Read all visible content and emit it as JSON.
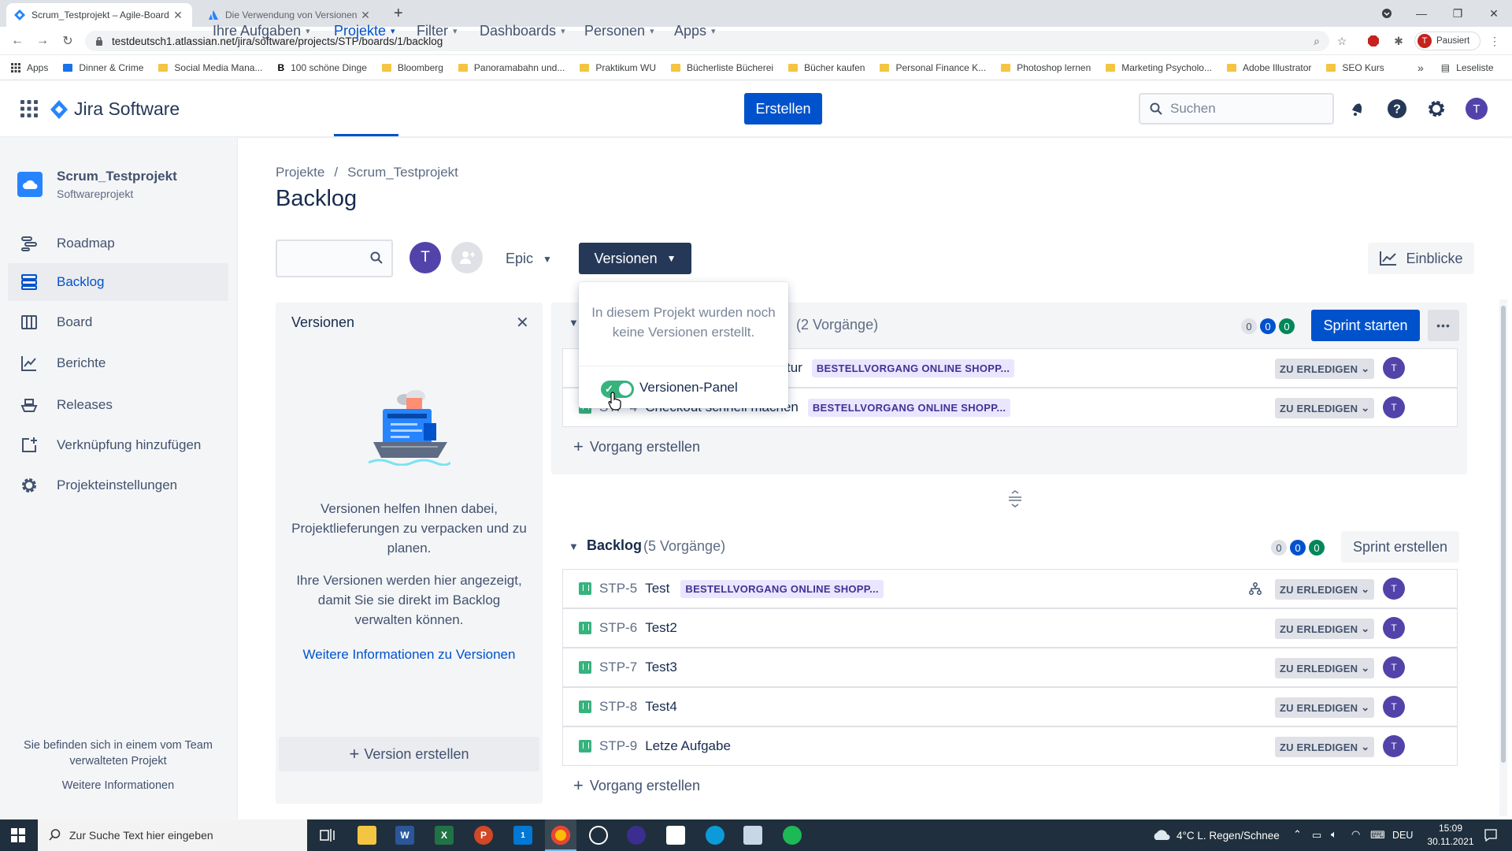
{
  "browser": {
    "tabs": [
      {
        "title": "Scrum_Testprojekt – Agile-Board"
      },
      {
        "title": "Die Verwendung von Versionen"
      }
    ],
    "url": "testdeutsch1.atlassian.net/jira/software/projects/STP/boards/1/backlog",
    "profile_label": "Pausiert",
    "profile_initial": "T",
    "bookmarks": [
      "Apps",
      "Dinner & Crime",
      "Social Media Mana...",
      "100 schöne Dinge",
      "Bloomberg",
      "Panoramabahn und...",
      "Praktikum WU",
      "Bücherliste Bücherei",
      "Bücher kaufen",
      "Personal Finance K...",
      "Photoshop lernen",
      "Marketing Psycholo...",
      "Adobe Illustrator",
      "SEO Kurs"
    ],
    "more_bookmarks": "»",
    "reading_list": "Leseliste"
  },
  "jira": {
    "product": "Jira Software",
    "nav": [
      {
        "label": "Ihre Aufgaben"
      },
      {
        "label": "Projekte"
      },
      {
        "label": "Filter"
      },
      {
        "label": "Dashboards"
      },
      {
        "label": "Personen"
      },
      {
        "label": "Apps"
      }
    ],
    "create_label": "Erstellen",
    "search_placeholder": "Suchen",
    "user_initial": "T",
    "accent": "#0052cc"
  },
  "sidebar": {
    "project_name": "Scrum_Testprojekt",
    "project_type": "Softwareprojekt",
    "items": [
      {
        "label": "Roadmap",
        "icon": "roadmap-icon"
      },
      {
        "label": "Backlog",
        "icon": "backlog-icon"
      },
      {
        "label": "Board",
        "icon": "board-icon"
      },
      {
        "label": "Berichte",
        "icon": "reports-icon"
      },
      {
        "label": "Releases",
        "icon": "releases-icon"
      },
      {
        "label": "Verknüpfung hinzufügen",
        "icon": "add-shortcut-icon"
      },
      {
        "label": "Projekteinstellungen",
        "icon": "settings-icon"
      }
    ],
    "footer_text": "Sie befinden sich in einem vom Team verwalteten Projekt",
    "footer_link": "Weitere Informationen"
  },
  "main": {
    "breadcrumb": [
      "Projekte",
      "Scrum_Testprojekt"
    ],
    "breadcrumb_sep": "/",
    "title": "Backlog",
    "filter_avatar": "T",
    "epic_label": "Epic",
    "versions_label": "Versionen",
    "insights_label": "Einblicke"
  },
  "versions_dropdown": {
    "message": "In diesem Projekt wurden noch keine Versionen erstellt.",
    "toggle_label": "Versionen-Panel",
    "toggle_on": true
  },
  "versions_panel": {
    "title": "Versionen",
    "text1": "Versionen helfen Ihnen dabei, Projektlieferungen zu verpacken und zu planen.",
    "text2": "Ihre Versionen werden hier angezeigt, damit Sie sie direkt im Backlog verwalten können.",
    "link": "Weitere Informationen zu Versionen",
    "create_label": "Version erstellen"
  },
  "sprint": {
    "count_label": "(2 Vorgänge)",
    "badges": [
      "0",
      "0",
      "0"
    ],
    "start_label": "Sprint starten",
    "more_label": "•••",
    "rows": [
      {
        "key": "",
        "summary": "tur",
        "epic": "BESTELLVORGANG ONLINE SHOPP...",
        "status": "ZU ERLEDIGEN",
        "assignee": "T"
      },
      {
        "key": "STP-4",
        "summary": "Checkout schnell machen",
        "epic": "BESTELLVORGANG ONLINE SHOPP...",
        "status": "ZU ERLEDIGEN",
        "assignee": "T"
      }
    ],
    "create_issue": "Vorgang erstellen"
  },
  "backlog": {
    "title": "Backlog",
    "count_label": "(5 Vorgänge)",
    "badges": [
      "0",
      "0",
      "0"
    ],
    "create_sprint": "Sprint erstellen",
    "rows": [
      {
        "key": "STP-5",
        "summary": "Test",
        "epic": "BESTELLVORGANG ONLINE SHOPP...",
        "status": "ZU ERLEDIGEN",
        "assignee": "T"
      },
      {
        "key": "STP-6",
        "summary": "Test2",
        "epic": "",
        "status": "ZU ERLEDIGEN",
        "assignee": "T"
      },
      {
        "key": "STP-7",
        "summary": "Test3",
        "epic": "",
        "status": "ZU ERLEDIGEN",
        "assignee": "T"
      },
      {
        "key": "STP-8",
        "summary": "Test4",
        "epic": "",
        "status": "ZU ERLEDIGEN",
        "assignee": "T"
      },
      {
        "key": "STP-9",
        "summary": "Letze Aufgabe",
        "epic": "",
        "status": "ZU ERLEDIGEN",
        "assignee": "T"
      }
    ],
    "create_issue": "Vorgang erstellen"
  },
  "taskbar": {
    "search_placeholder": "Zur Suche Text hier eingeben",
    "weather": "4°C  L. Regen/Schnee",
    "lang": "DEU",
    "time": "15:09",
    "date": "30.11.2021",
    "mail_count": "1"
  }
}
